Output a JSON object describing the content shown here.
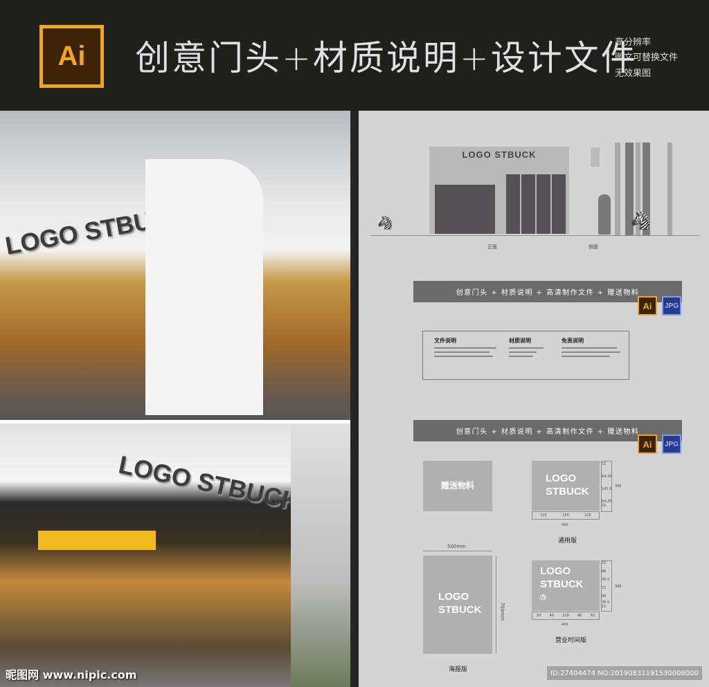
{
  "header": {
    "logo": "Ai",
    "title": "创意门头+材质说明+设计文件",
    "features": [
      "高分辨率",
      "图文可替换文件",
      "无效果图"
    ]
  },
  "photos": {
    "sign_text": "LOGO STBUCK",
    "watermark": "昵图网 www.nipic.com"
  },
  "elevation": {
    "sign_text": "LOGO  STBUCK",
    "front_label": "正面",
    "side_label": "侧面"
  },
  "banners": {
    "text": "创意门头 + 材质说明 + 高清制作文件 + 赠送物料",
    "ai_badge": "Ai",
    "jpg_badge": "JPG"
  },
  "info": {
    "col1": "文件说明",
    "col2": "材质说明",
    "col3": "免责说明"
  },
  "gift": {
    "label": "赠送物料"
  },
  "sign_general": {
    "line1": "LOGO",
    "line2": "STBUCK",
    "dims_right": [
      "15",
      "64.25",
      "141.5",
      "64.25",
      "15"
    ],
    "height": "300",
    "dims_bottom": [
      "125",
      "150",
      "125"
    ],
    "width": "400",
    "caption": "通用版"
  },
  "poster": {
    "line1": "LOGO",
    "line2": "STBUCK",
    "width": "500mm",
    "height": "700mm",
    "caption": "海报版"
  },
  "sign_hours": {
    "line1": "LOGO",
    "line2": "STBUCK",
    "dims_right": [
      "15",
      "66",
      "56.5",
      "72",
      "40",
      "35.5",
      "15"
    ],
    "height": "300",
    "dims_bottom": [
      "50",
      "40",
      "220",
      "40",
      "50"
    ],
    "width": "400",
    "caption": "营业时间版"
  },
  "footer": {
    "id": "ID:27404474 NO:20190831191530008000"
  },
  "colors": {
    "header_bg": "#1f1f1d",
    "ai_orange": "#f2a51d",
    "panel_bg": "#d4d4d4",
    "banner": "#6b6b6b"
  }
}
